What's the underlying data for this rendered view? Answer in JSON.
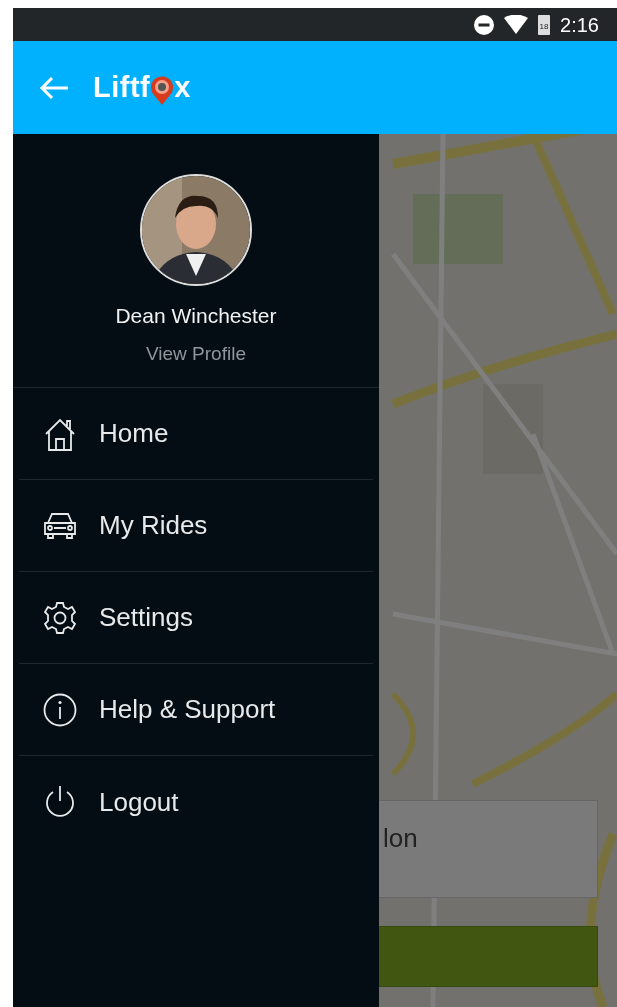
{
  "status_bar": {
    "battery": "18",
    "time": "2:16"
  },
  "app_bar": {
    "logo_start": "Liftf",
    "logo_end": "x"
  },
  "drawer": {
    "profile": {
      "name": "Dean Winchester",
      "link": "View Profile"
    },
    "items": [
      {
        "label": "Home"
      },
      {
        "label": "My Rides"
      },
      {
        "label": "Settings"
      },
      {
        "label": "Help & Support"
      },
      {
        "label": "Logout"
      }
    ]
  },
  "background": {
    "card_text": "lon"
  }
}
